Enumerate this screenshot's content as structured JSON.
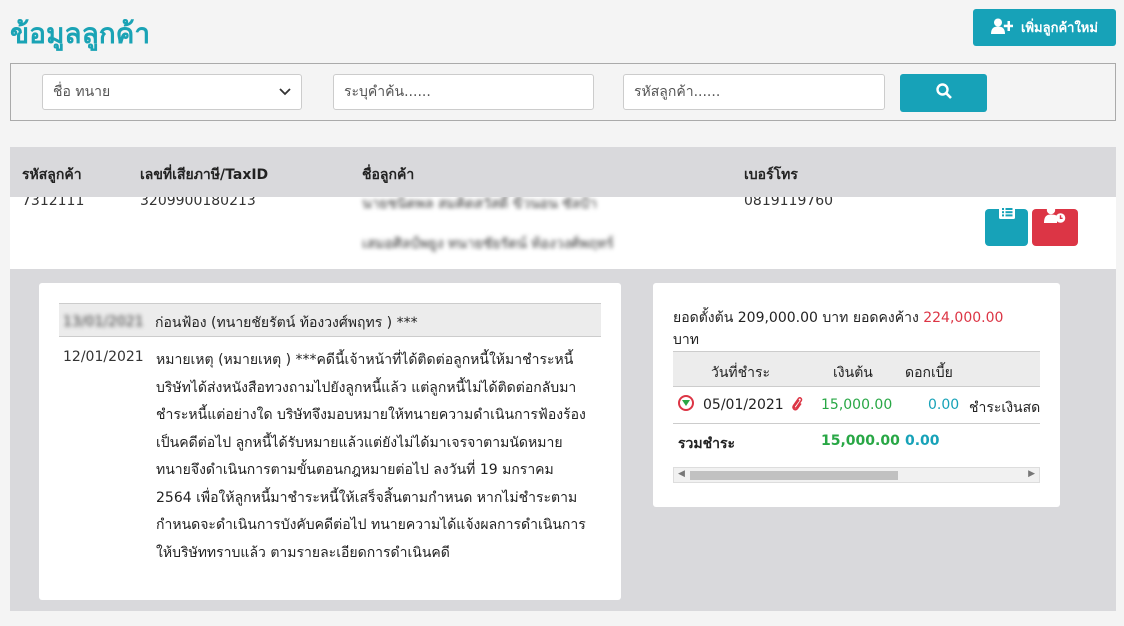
{
  "header": {
    "title": "ข้อมูลลูกค้า",
    "add_button_label": "เพิ่มลูกค้าใหม่"
  },
  "search": {
    "filter_selected": "ชื่อ ทนาย",
    "keyword_placeholder": "ระบุคำค้น......",
    "customer_code_placeholder": "รหัสลูกค้า......"
  },
  "table": {
    "columns": [
      "รหัสลูกค้า",
      "เลขที่เสียภาษี/TaxID",
      "ชื่อลูกค้า",
      "เบอร์โทร"
    ],
    "row": {
      "code": "7312111",
      "tax_id": "3209900180213",
      "name_line1": "นายชนิตพล สมคิดสวัสดิ์ ขีวนอน ซัลป้า",
      "name_line2": "เสมอศิลป์พยูง ทนายชัยรัตน์ ท้องวงศ์พฤทร์",
      "phone": "0819119760"
    }
  },
  "notes": [
    {
      "date": "13/01/2021",
      "text": "ก่อนฟ้อง (ทนายชัยรัตน์ ท้องวงศ์พฤทร ) ***"
    },
    {
      "date": "12/01/2021",
      "text": "หมายเหตุ (หมายเหตุ ) ***คดีนี้เจ้าหน้าที่ได้ติดต่อลูกหนี้ให้มาชำระหนี้ บริษัทได้ส่งหนังสือทวงถามไปยังลูกหนี้แล้ว แต่ลูกหนี้ไม่ได้ติดต่อกลับมาชำระหนี้แต่อย่างใด บริษัทจึงมอบหมายให้ทนายความดำเนินการฟ้องร้องเป็นคดีต่อไป ลูกหนี้ได้รับหมายแล้วแต่ยังไม่ได้มาเจรจาตามนัดหมาย ทนายจึงดำเนินการตามขั้นตอนกฎหมายต่อไป ลงวันที่ 19 มกราคม 2564 เพื่อให้ลูกหนี้มาชำระหนี้ให้เสร็จสิ้นตามกำหนด หากไม่ชำระตามกำหนดจะดำเนินการบังคับคดีต่อไป ทนายความได้แจ้งผลการดำเนินการให้บริษัททราบแล้ว ตามรายละเอียดการดำเนินคดี"
    }
  ],
  "summary": {
    "label_initial": "ยอดตั้งต้น",
    "initial_amount": "209,000.00",
    "unit": "บาท",
    "label_outstanding": "ยอดคงค้าง",
    "outstanding_amount": "224,000.00",
    "colors": {
      "outstanding": "#dc3545",
      "principal": "#28a745",
      "interest": "#17a2b8"
    }
  },
  "payments": {
    "columns": [
      "วันที่ชำระ",
      "เงินต้น",
      "ดอกเบี้ย"
    ],
    "rows": [
      {
        "date": "05/01/2021",
        "principal": "15,000.00",
        "interest": "0.00",
        "note": "ชำระเงินสด"
      }
    ],
    "total_label": "รวมชำระ",
    "total_principal": "15,000.00",
    "total_interest": "0.00"
  }
}
